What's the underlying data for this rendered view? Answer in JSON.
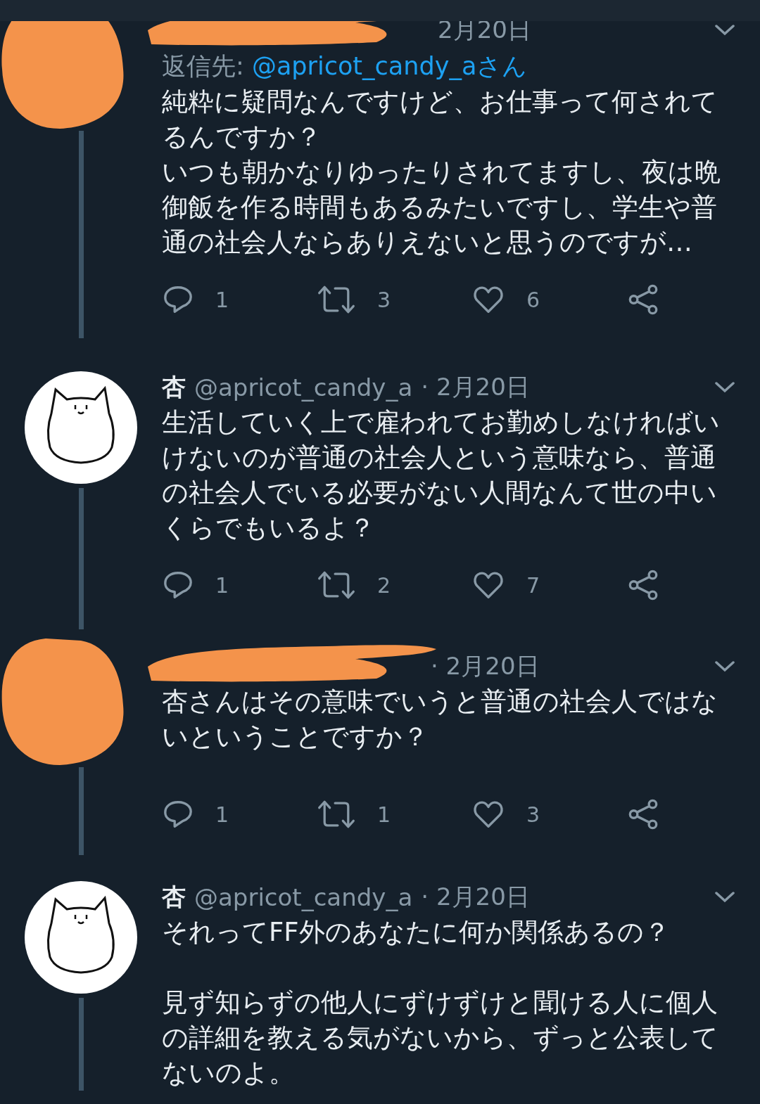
{
  "tweets": [
    {
      "kind": "redacted",
      "date": "2月20日",
      "reply_to": {
        "label": "返信先: ",
        "handle": "@apricot_candy_aさん"
      },
      "text_blocks": [
        [
          "純粋に疑問なんですけど、お仕事って何されてるんですか？",
          "いつも朝かなりゆったりされてますし、夜は晩御飯を作る時間もあるみたいですし、学生や普通の社会人ならありえないと思うのですが…"
        ]
      ],
      "replies": "1",
      "retweets": "3",
      "likes": "6",
      "thread_below": true
    },
    {
      "kind": "author",
      "name": "杏",
      "handle": "@apricot_candy_a",
      "date": "· 2月20日",
      "text_blocks": [
        [
          "生活していく上で雇われてお勤めしなければいけないのが普通の社会人という意味なら、普通の社会人でいる必要がない人間なんて世の中いくらでもいるよ？"
        ]
      ],
      "replies": "1",
      "retweets": "2",
      "likes": "7",
      "thread_below": true
    },
    {
      "kind": "redacted",
      "date": "· 2月20日",
      "text_blocks": [
        [
          "杏さんはその意味でいうと普通の社会人ではないということですか？"
        ]
      ],
      "replies": "1",
      "retweets": "1",
      "likes": "3",
      "thread_below": true
    },
    {
      "kind": "author",
      "name": "杏",
      "handle": "@apricot_candy_a",
      "date": "· 2月20日",
      "text_blocks": [
        [
          "それってFF外のあなたに何か関係あるの？"
        ],
        [
          "見ず知らずの他人にずけずけと聞ける人に個人の詳細を教える気がないから、ずっと公表してないのよ。"
        ]
      ],
      "thread_below": true
    }
  ]
}
